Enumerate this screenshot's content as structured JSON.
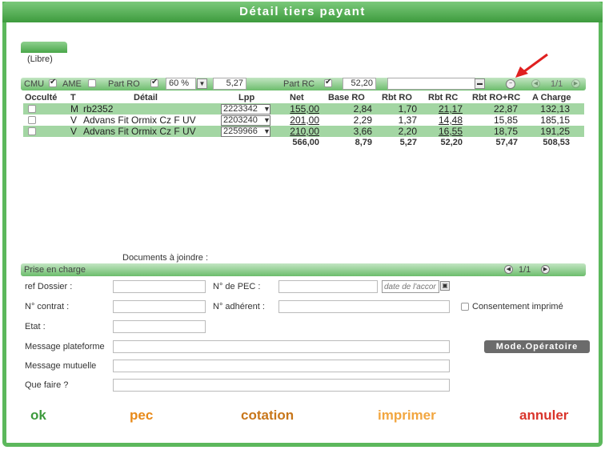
{
  "window": {
    "title": "Détail tiers payant"
  },
  "libre_label": "(Libre)",
  "options_bar": {
    "cmu_label": "CMU",
    "ame_label": "AME",
    "part_ro_label": "Part RO",
    "part_ro_percent": "60 %",
    "part_ro_value": "5,27",
    "part_rc_label": "Part RC",
    "part_rc_value": "52,20",
    "pager": "1/1",
    "minus_glyph": "▬"
  },
  "table": {
    "headers": {
      "occulte": "Occulté",
      "t": "T",
      "detail": "Détail",
      "lpp": "Lpp",
      "net": "Net",
      "base_ro": "Base RO",
      "rbt_ro": "Rbt RO",
      "rbt_rc": "Rbt RC",
      "rbt_rorc": "Rbt RO+RC",
      "a_charge": "A Charge"
    },
    "rows": [
      {
        "t": "M",
        "detail": "rb2352",
        "lpp": "2223342",
        "net": "155,00",
        "base_ro": "2,84",
        "rbt_ro": "1,70",
        "rbt_rc": "21,17",
        "rbt_rorc": "22,87",
        "a_charge": "132,13"
      },
      {
        "t": "V",
        "detail": "Advans Fit Ormix Cz F UV",
        "lpp": "2203240",
        "net": "201,00",
        "base_ro": "2,29",
        "rbt_ro": "1,37",
        "rbt_rc": "14,48",
        "rbt_rorc": "15,85",
        "a_charge": "185,15"
      },
      {
        "t": "V",
        "detail": "Advans Fit Ormix Cz F UV",
        "lpp": "2259966",
        "net": "210,00",
        "base_ro": "3,66",
        "rbt_ro": "2,20",
        "rbt_rc": "16,55",
        "rbt_rorc": "18,75",
        "a_charge": "191,25"
      }
    ],
    "totals": {
      "net": "566,00",
      "base_ro": "8,79",
      "rbt_ro": "5,27",
      "rbt_rc": "52,20",
      "rbt_rorc": "57,47",
      "a_charge": "508,53"
    }
  },
  "documents_label": "Documents à joindre :",
  "prise_en_charge": {
    "label": "Prise en charge",
    "pager": "1/1"
  },
  "form": {
    "ref_dossier": "ref Dossier :",
    "num_pec": "N° de PEC :",
    "date_placeholder": "date de l'accor",
    "num_contrat": "N° contrat :",
    "num_adherent": "N° adhérent :",
    "consentement": "Consentement imprimé",
    "etat": "Etat :",
    "message_plateforme": "Message plateforme",
    "message_mutuelle": "Message mutuelle",
    "que_faire": "Que faire ?"
  },
  "mode_operatoire": "Mode.Opératoire",
  "actions": {
    "ok": "ok",
    "pec": "pec",
    "cotation": "cotation",
    "imprimer": "imprimer",
    "annuler": "annuler"
  },
  "colors": {
    "brand_green": "#5cb85c",
    "row_green": "#a3d6a3",
    "ok": "#3c9a3c",
    "pec": "#e88a1a",
    "cotation": "#c8761a",
    "imprimer": "#f2a640",
    "annuler": "#d9342b",
    "pointer_arrow": "#e02020"
  }
}
